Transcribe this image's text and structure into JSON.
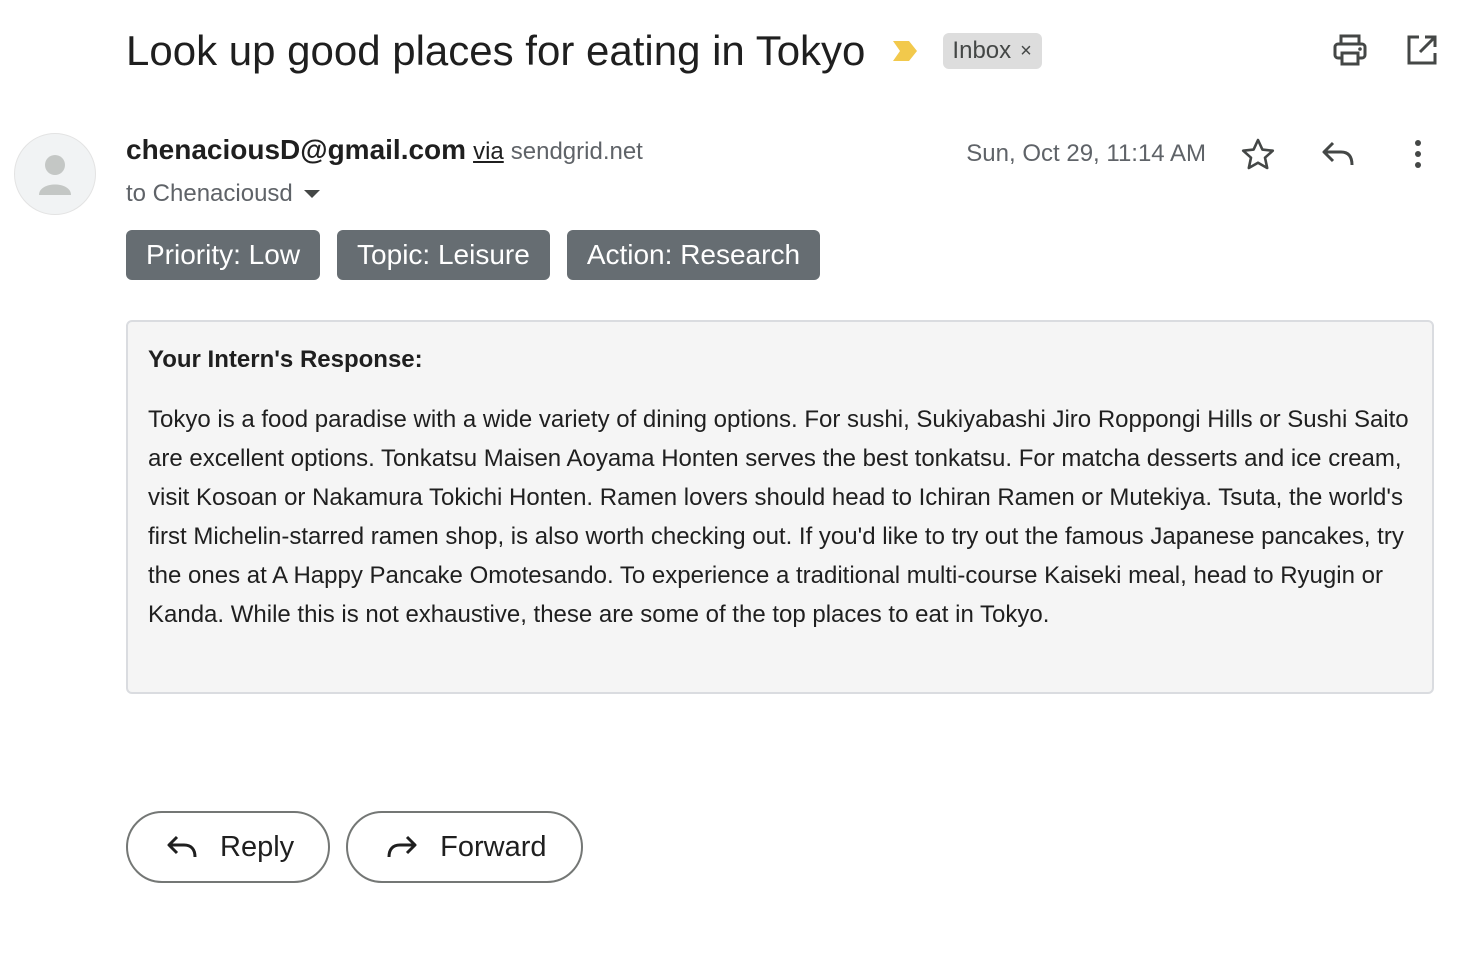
{
  "email": {
    "subject": "Look up good places for eating in Tokyo",
    "inbox_label": "Inbox",
    "inbox_remove": "×",
    "sender_email": "chenaciousD@gmail.com",
    "via_text": "via",
    "via_domain": "sendgrid.net",
    "to_text": "to Chenaciousd",
    "date": "Sun, Oct 29, 11:14 AM",
    "labels": [
      "Priority: Low",
      "Topic: Leisure",
      "Action: Research"
    ],
    "response_heading": "Your Intern's Response:",
    "response_body": "Tokyo is a food paradise with a wide variety of dining options. For sushi, Sukiyabashi Jiro Roppongi Hills or Sushi Saito are excellent options. Tonkatsu Maisen Aoyama Honten serves the best tonkatsu. For matcha desserts and ice cream, visit Kosoan or Nakamura Tokichi Honten. Ramen lovers should head to Ichiran Ramen or Mutekiya. Tsuta, the world's first Michelin-starred ramen shop, is also worth checking out. If you'd like to try out the famous Japanese pancakes, try the ones at A Happy Pancake Omotesando. To experience a traditional multi-course Kaiseki meal, head to Ryugin or Kanda. While this is not exhaustive, these are some of the top places to eat in Tokyo."
  },
  "actions": {
    "reply_label": "Reply",
    "forward_label": "Forward"
  },
  "icons": {
    "importance": "importance-marker-icon",
    "print": "print-icon",
    "open_new_window": "open-in-new-window-icon",
    "star": "star-icon",
    "reply": "reply-icon",
    "more": "more-vert-icon",
    "avatar": "default-avatar-icon"
  },
  "colors": {
    "importance_marker": "#f2c94c",
    "label_chip": "#666d72",
    "inbox_chip": "#dddddd"
  }
}
